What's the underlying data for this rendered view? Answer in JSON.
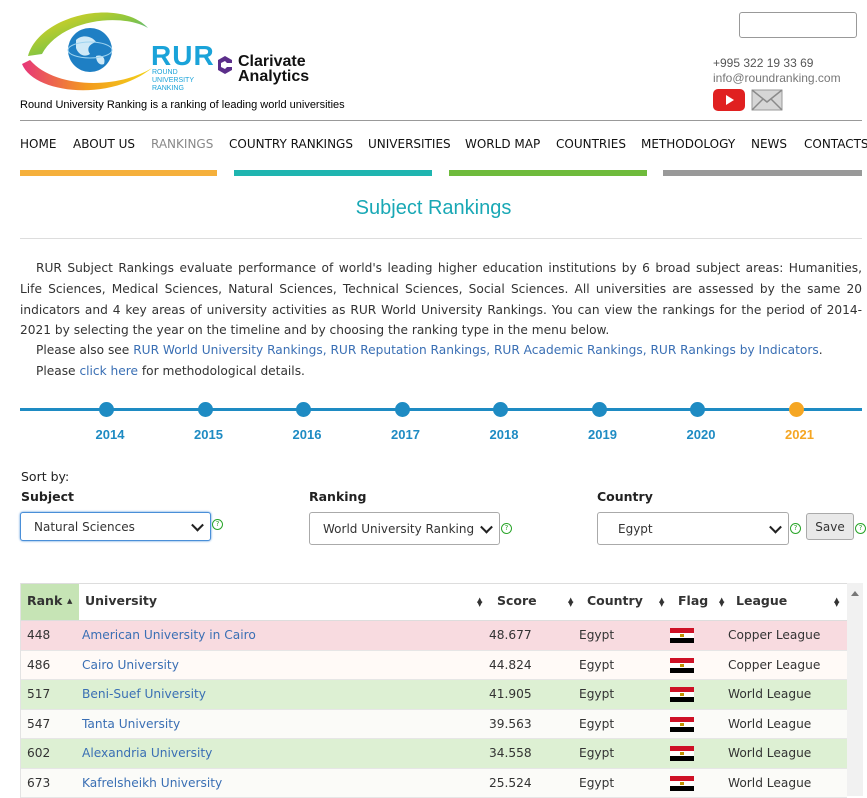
{
  "header": {
    "logo_main": "RUR",
    "logo_sub": "ROUND UNIVERSITY RANKING",
    "partner": "Clarivate Analytics",
    "tagline": "Round University Ranking is a ranking of leading world universities",
    "phone": "+995 322 19 33 69",
    "email": "info@roundranking.com",
    "search_placeholder": ""
  },
  "nav": {
    "items": [
      "HOME",
      "ABOUT US",
      "RANKINGS",
      "COUNTRY RANKINGS",
      "UNIVERSITIES",
      "WORLD MAP",
      "COUNTRIES",
      "METHODOLOGY",
      "NEWS",
      "CONTACTS"
    ],
    "active": "RANKINGS",
    "bar_colors": [
      "#f5b03c",
      "#1fb5b0",
      "#6fbb3c",
      "#999999"
    ]
  },
  "page": {
    "title": "Subject Rankings",
    "intro": "RUR Subject Rankings evaluate performance of world's leading higher education institutions by 6 broad subject areas: Humanities, Life Sciences, Medical Sciences, Natural Sciences, Technical Sciences, Social Sciences. All universities are assessed by the same 20 indicators and 4 key areas of university activities as RUR World University Rankings. You can view the rankings for the period of 2014-2021 by selecting the year on the timeline and by choosing the ranking type in the menu below.",
    "also_see_prefix": "Please also see ",
    "link_world": "RUR World University Rankings,",
    "link_reputation": "RUR Reputation Rankings,",
    "link_academic": "RUR Academic Rankings,",
    "link_indicators": "RUR Rankings by Indicators",
    "also_see_suffix": ".",
    "please_prefix": "Please ",
    "click_here": "click here",
    "please_suffix": " for methodological details."
  },
  "timeline": {
    "years": [
      "2014",
      "2015",
      "2016",
      "2017",
      "2018",
      "2019",
      "2020",
      "2021"
    ],
    "selected": "2021",
    "color": "#1e8bc3",
    "selected_color": "#f5a623"
  },
  "filters": {
    "sort_by": "Sort by:",
    "subject_label": "Subject",
    "subject_value": "Natural Sciences",
    "ranking_label": "Ranking",
    "ranking_value": "World University Ranking",
    "country_label": "Country",
    "country_value": "Egypt",
    "help": "?",
    "save": "Save"
  },
  "table": {
    "headers": {
      "rank": "Rank",
      "university": "University",
      "score": "Score",
      "country": "Country",
      "flag": "Flag",
      "league": "League"
    },
    "rows": [
      {
        "rank": "448",
        "university": "American University in Cairo",
        "score": "48.677",
        "country": "Egypt",
        "league": "Copper League",
        "bg": "#f8dbe0"
      },
      {
        "rank": "486",
        "university": "Cairo University",
        "score": "44.824",
        "country": "Egypt",
        "league": "Copper League",
        "bg": "#fffaf7"
      },
      {
        "rank": "517",
        "university": "Beni-Suef University",
        "score": "41.905",
        "country": "Egypt",
        "league": "World League",
        "bg": "#ddf0d3"
      },
      {
        "rank": "547",
        "university": "Tanta University",
        "score": "39.563",
        "country": "Egypt",
        "league": "World League",
        "bg": "#fbfbf8"
      },
      {
        "rank": "602",
        "university": "Alexandria University",
        "score": "34.558",
        "country": "Egypt",
        "league": "World League",
        "bg": "#ddf0d3"
      },
      {
        "rank": "673",
        "university": "Kafrelsheikh University",
        "score": "25.524",
        "country": "Egypt",
        "league": "World League",
        "bg": "#fbfbf8"
      }
    ]
  }
}
